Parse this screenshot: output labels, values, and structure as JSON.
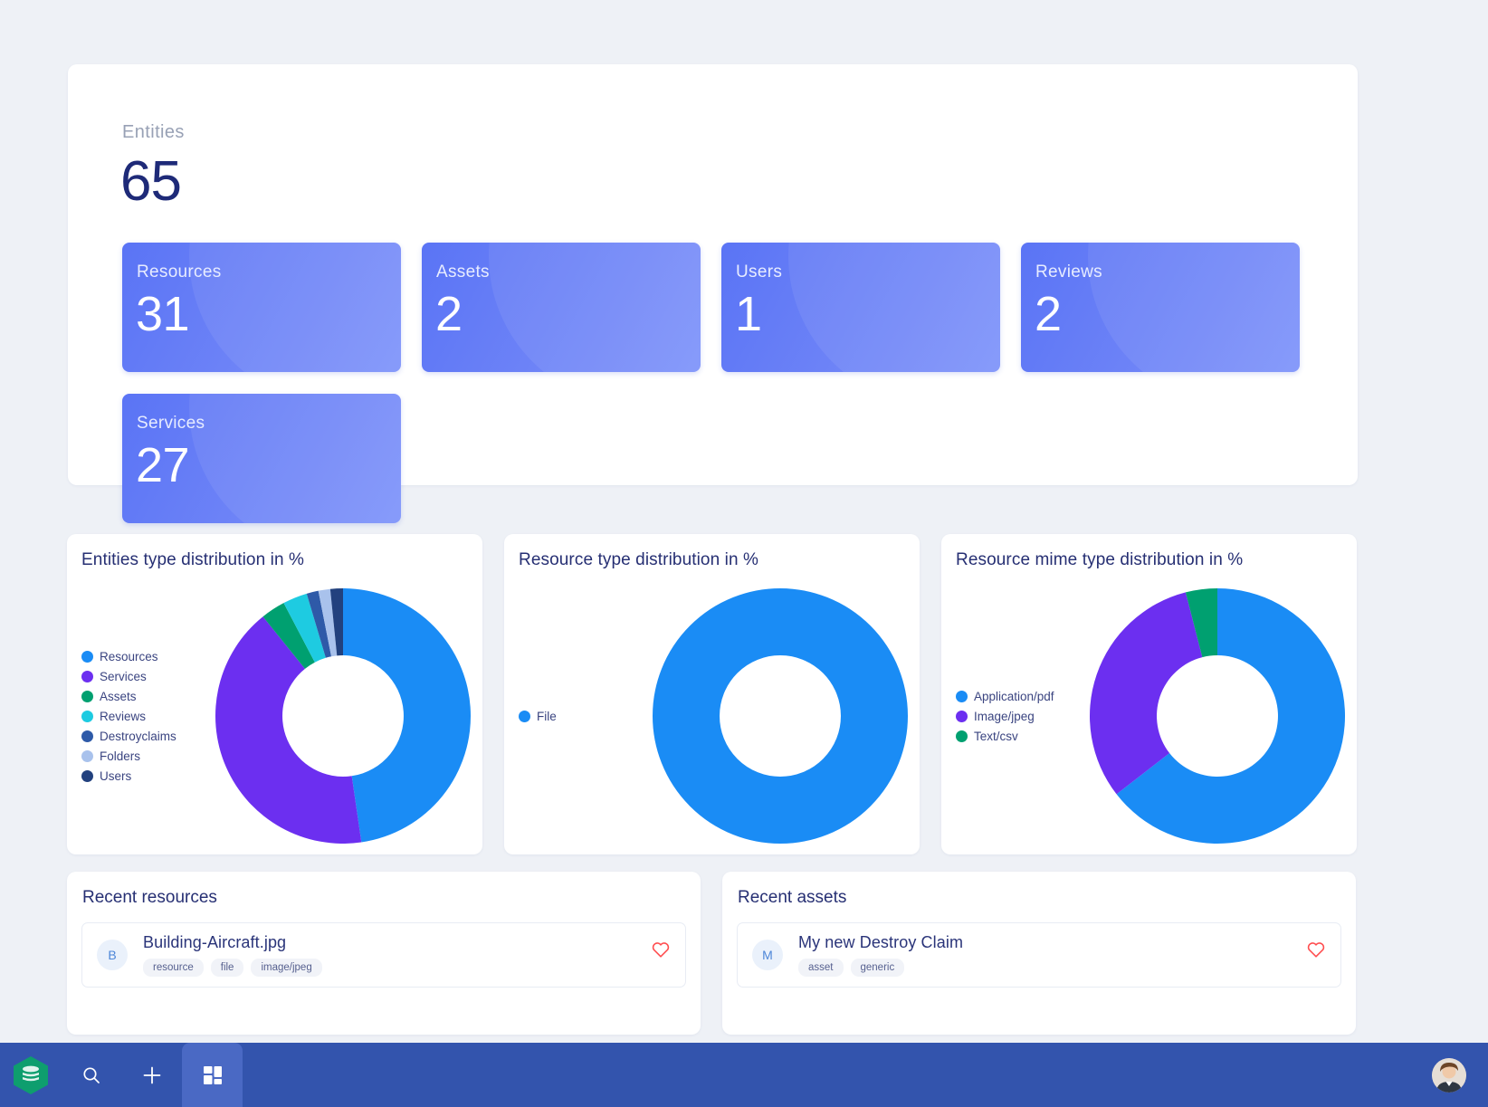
{
  "summary": {
    "label": "Entities",
    "value": "65",
    "cards": [
      {
        "label": "Resources",
        "value": "31"
      },
      {
        "label": "Assets",
        "value": "2"
      },
      {
        "label": "Users",
        "value": "1"
      },
      {
        "label": "Reviews",
        "value": "2"
      },
      {
        "label": "Services",
        "value": "27"
      }
    ]
  },
  "chart_data": [
    {
      "type": "pie",
      "title": "Entities type distribution in %",
      "legend_position": "left",
      "categories": [
        "Resources",
        "Services",
        "Assets",
        "Reviews",
        "Destroyclaims",
        "Folders",
        "Users"
      ],
      "values": [
        47.7,
        41.5,
        3.1,
        3.1,
        1.5,
        1.5,
        1.6
      ],
      "colors": [
        "#1a8cf5",
        "#6c2ff0",
        "#00a070",
        "#1ecbe1",
        "#2e5aa8",
        "#a9c2ec",
        "#22417e"
      ]
    },
    {
      "type": "pie",
      "title": "Resource type distribution in %",
      "legend_position": "left",
      "categories": [
        "File"
      ],
      "values": [
        100
      ],
      "colors": [
        "#1a8cf5"
      ]
    },
    {
      "type": "pie",
      "title": "Resource mime type distribution in %",
      "legend_position": "left",
      "categories": [
        "Application/pdf",
        "Image/jpeg",
        "Text/csv"
      ],
      "values": [
        64.5,
        31.5,
        4.0
      ],
      "colors": [
        "#1a8cf5",
        "#6c2ff0",
        "#00a070"
      ]
    }
  ],
  "recent_resources": {
    "title": "Recent resources",
    "items": [
      {
        "initial": "B",
        "name": "Building-Aircraft.jpg",
        "tags": [
          "resource",
          "file",
          "image/jpeg"
        ]
      }
    ]
  },
  "recent_assets": {
    "title": "Recent assets",
    "items": [
      {
        "initial": "M",
        "name": "My new Destroy Claim",
        "tags": [
          "asset",
          "generic"
        ]
      }
    ]
  },
  "bottom_nav": {
    "logo_icon": "hexagon-stack-logo",
    "items": [
      {
        "icon": "search-icon",
        "active": false
      },
      {
        "icon": "plus-icon",
        "active": false
      },
      {
        "icon": "dashboard-grid-icon",
        "active": true
      }
    ],
    "avatar_icon": "user-avatar"
  },
  "colors": {
    "accent": "#1a8cf5",
    "nav_bg": "#3354ad",
    "nav_active": "#4a69c4",
    "card_gradient_start": "#5a74f5",
    "card_gradient_end": "#7e93fa",
    "heart": "#ff4d4f",
    "page_bg": "#eef1f6",
    "heading": "#262f73"
  }
}
